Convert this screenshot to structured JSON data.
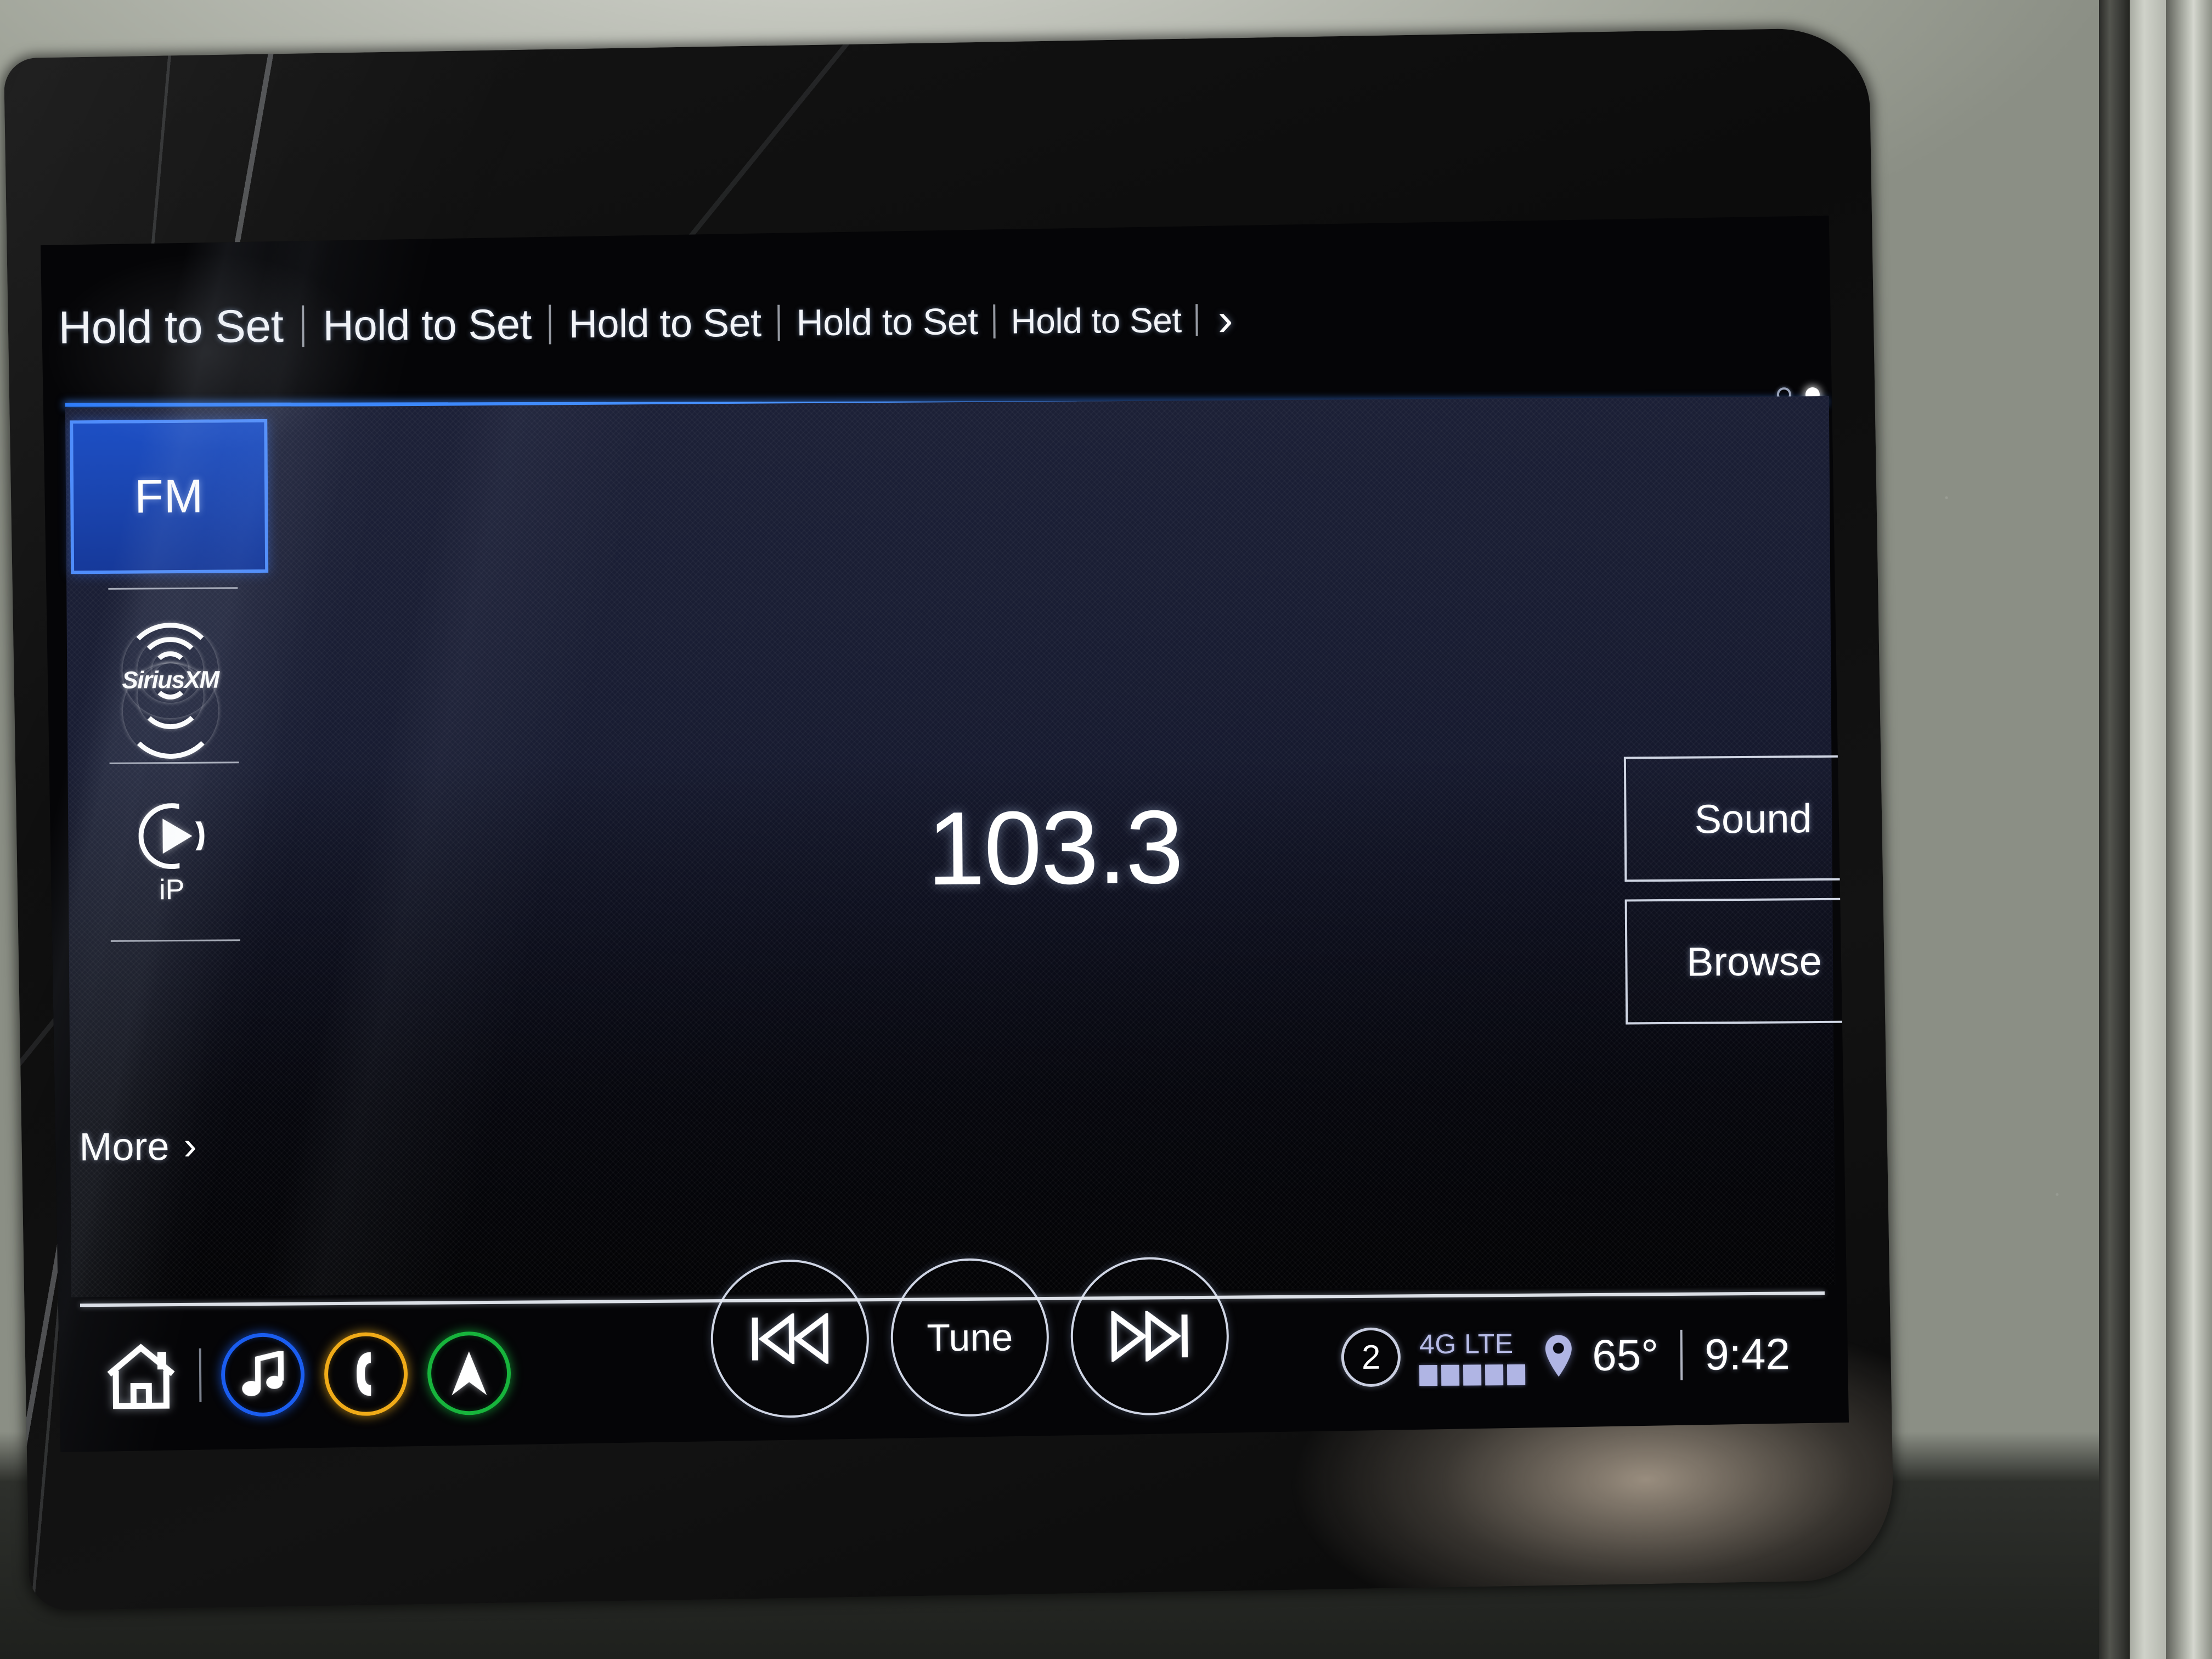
{
  "device": {
    "type": "car-infotainment-touchscreen"
  },
  "presets": {
    "items": [
      {
        "label": "Hold to Set"
      },
      {
        "label": "Hold to Set"
      },
      {
        "label": "Hold to Set"
      },
      {
        "label": "Hold to Set"
      },
      {
        "label": "Hold to Set"
      }
    ],
    "next_icon": "›",
    "page_dots": {
      "total": 2,
      "active_index": 1
    }
  },
  "sidebar": {
    "source_selected": "FM",
    "items": [
      {
        "label": "FM",
        "icon": "fm-source",
        "selected": true
      },
      {
        "label": "SiriusXM",
        "icon": "siriusxm-logo",
        "selected": false
      },
      {
        "label": "iP",
        "icon": "iheartradio-icon",
        "selected": false
      }
    ],
    "more_label": "More",
    "more_chevron": "›"
  },
  "now_playing": {
    "frequency": "103.3",
    "band": "FM"
  },
  "right_buttons": [
    {
      "label": "Sound",
      "icon": "sound-settings"
    },
    {
      "label": "Browse",
      "icon": "browse-list"
    }
  ],
  "transport": {
    "previous_label": "Previous",
    "tune_label": "Tune",
    "next_label": "Next"
  },
  "status_bar": {
    "home_icon": "home-icon",
    "shortcuts": [
      {
        "name": "music",
        "icon": "music-note-icon",
        "color": "#1a5df0"
      },
      {
        "name": "phone",
        "icon": "phone-handset-icon",
        "color": "#f0ab18"
      },
      {
        "name": "navigation",
        "icon": "navigation-arrow-icon",
        "color": "#17b43c"
      }
    ],
    "profile_number": "2",
    "network_label": "4G LTE",
    "signal_bars": 5,
    "signal_bars_total": 5,
    "location_icon": "location-pin-icon",
    "temperature": "65°",
    "time": "9:42"
  },
  "colors": {
    "accent_blue": "#1d4fc4",
    "accent_blue_border": "#4f8dfb",
    "separator_blue": "#3a82fa",
    "lte_lavender": "#b6bbe6",
    "music_blue": "#1a5df0",
    "phone_amber": "#f0ab18",
    "nav_green": "#17b43c",
    "panel_navy": "#1d2138",
    "screen_black": "#050507"
  }
}
